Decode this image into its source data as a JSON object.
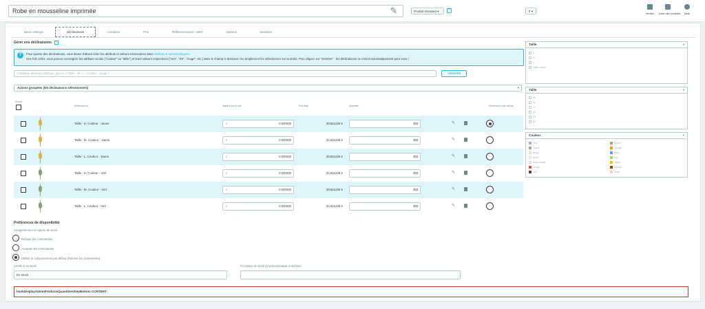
{
  "header": {
    "product_name": "Robe en mousseline imprimée",
    "product_type": "Produit standard",
    "lang": "fr",
    "toolbar": [
      {
        "label": "Ventes",
        "icon": "stats-icon"
      },
      {
        "label": "Liste des produits",
        "icon": "list-icon"
      },
      {
        "label": "Aide",
        "icon": "help-icon"
      }
    ]
  },
  "tabs": [
    "Basic settings",
    "Déclinaisons",
    "Livraison",
    "Prix",
    "Référencement - SEO",
    "Options",
    "Modules"
  ],
  "tabs_active": 1,
  "section": {
    "title": "Gérer vos déclinaisons"
  },
  "info": {
    "line1_pre": "Pour ajouter des déclinaisons, vous devez d'abord créer les attributs et valeurs nécessaires dans",
    "line1_link": "Attributs & caractéristiques",
    "line2": "Une fois créés, vous pouvez renseigner les attributs voulus (\"couleur\" ou \"taille\") et leurs valeurs respectives (\"vert\", \"XS\", \"rouge\", etc.) dans le champ ci-dessous. Ou simplement les sélectionner sur la droite. Puis cliquez sur \"Générer\" : les déclinaisons se créent automatiquement pour vous !"
  },
  "combine_placeholder": "Combiner plusieurs attributs, par ex. « Taille : all », « Couleur : rouge ».",
  "generate_label": "GÉNÉRER",
  "bulk_label": "Actions groupées (0/6 déclinaisons sélectionnées)",
  "table": {
    "select_all": "Choisir",
    "headers": [
      "Déclinaisons",
      "Impact sur le prix",
      "Prix final",
      "Quantité",
      "Déclinaison par défaut"
    ],
    "rows": [
      {
        "name": "Taille - S, Couleur - Jaune",
        "currency": "€",
        "impact": "0.000000",
        "final": "20.501236 €",
        "qty": "300",
        "default": true
      },
      {
        "name": "Taille - M, Couleur - Jaune",
        "currency": "€",
        "impact": "0.000000",
        "final": "20.501236 €",
        "qty": "300",
        "default": false
      },
      {
        "name": "Taille - L, Couleur - Jaune",
        "currency": "€",
        "impact": "0.000000",
        "final": "20.501236 €",
        "qty": "300",
        "default": false
      },
      {
        "name": "Taille - S, Couleur - Vert",
        "currency": "€",
        "impact": "0.000000",
        "final": "20.501236 €",
        "qty": "300",
        "default": false
      },
      {
        "name": "Taille - M, Couleur - Vert",
        "currency": "€",
        "impact": "0.000000",
        "final": "20.501236 €",
        "qty": "300",
        "default": false
      },
      {
        "name": "Taille - L, Couleur - Vert",
        "currency": "€",
        "impact": "0.000000",
        "final": "20.501236 €",
        "qty": "300",
        "default": false
      }
    ]
  },
  "availability": {
    "title": "Préférences de disponibilité",
    "behaviour_label": "Comportement si rupture de stock",
    "options": [
      {
        "label": "Refuser les commandes",
        "checked": false
      },
      {
        "label": "Accepter les commandes",
        "checked": false
      },
      {
        "label": "Utiliser le comportement par défaut (Refuser les commandes)",
        "checked": true
      }
    ],
    "instock_label": "Libellé si en stock",
    "instock_value": "En stock",
    "oos_label": "Si rupture de stock (et précommande autorisée)",
    "oos_value": ""
  },
  "hook": "hookDisplayAdminProductsQuantitiesStepBottom CONTENT",
  "panels": {
    "taille1": {
      "title": "Taille",
      "items": [
        "S",
        "M",
        "L",
        "Taille unique"
      ]
    },
    "taille2": {
      "title": "Taille",
      "items": [
        "35",
        "36",
        "37",
        "38",
        "39",
        "40"
      ]
    },
    "couleur": {
      "title": "Couleur",
      "col1": [
        {
          "label": "Gris",
          "color": "#aab2bd"
        },
        {
          "label": "Taupe",
          "color": "#b2a296"
        },
        {
          "label": "Beige",
          "color": "#f5f5dc"
        },
        {
          "label": "Blanc",
          "color": "#ffffff"
        },
        {
          "label": "Blanc cassé",
          "color": "#f4f4f4"
        },
        {
          "label": "Rouge",
          "color": "#e84c3d"
        },
        {
          "label": "Noir",
          "color": "#434a54"
        }
      ],
      "col2": [
        {
          "label": "Camel",
          "color": "#c19a6b"
        },
        {
          "label": "Orange",
          "color": "#f39c11"
        },
        {
          "label": "Bleu",
          "color": "#5d9cec"
        },
        {
          "label": "Vert",
          "color": "#a0d468"
        },
        {
          "label": "Jaune",
          "color": "#f1c40f"
        },
        {
          "label": "Marron",
          "color": "#964b00"
        },
        {
          "label": "Rose",
          "color": "#fcccd1"
        }
      ]
    }
  }
}
